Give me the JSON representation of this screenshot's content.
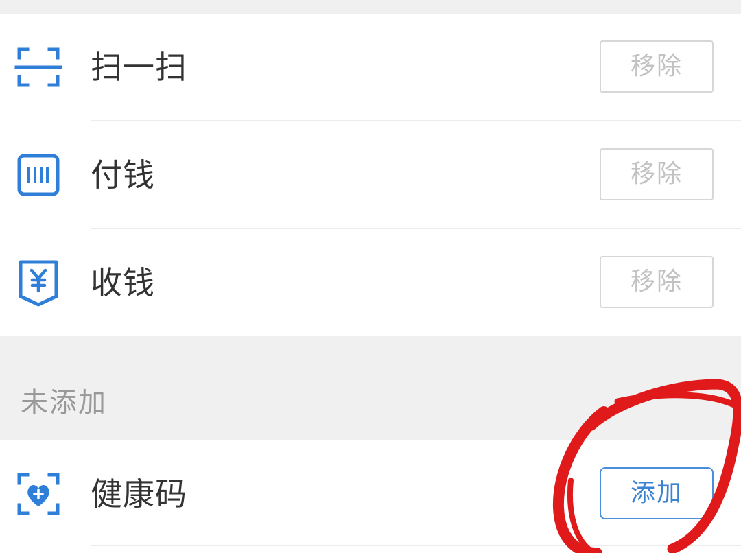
{
  "added": {
    "items": [
      {
        "label": "扫一扫",
        "icon": "scan-icon",
        "action": "移除"
      },
      {
        "label": "付钱",
        "icon": "barcode-pay-icon",
        "action": "移除"
      },
      {
        "label": "收钱",
        "icon": "yuan-receive-icon",
        "action": "移除"
      }
    ]
  },
  "not_added": {
    "title": "未添加",
    "items": [
      {
        "label": "健康码",
        "icon": "health-code-icon",
        "action": "添加"
      }
    ]
  },
  "colors": {
    "accent": "#2f7fd8",
    "annotation": "#e01a1a"
  }
}
